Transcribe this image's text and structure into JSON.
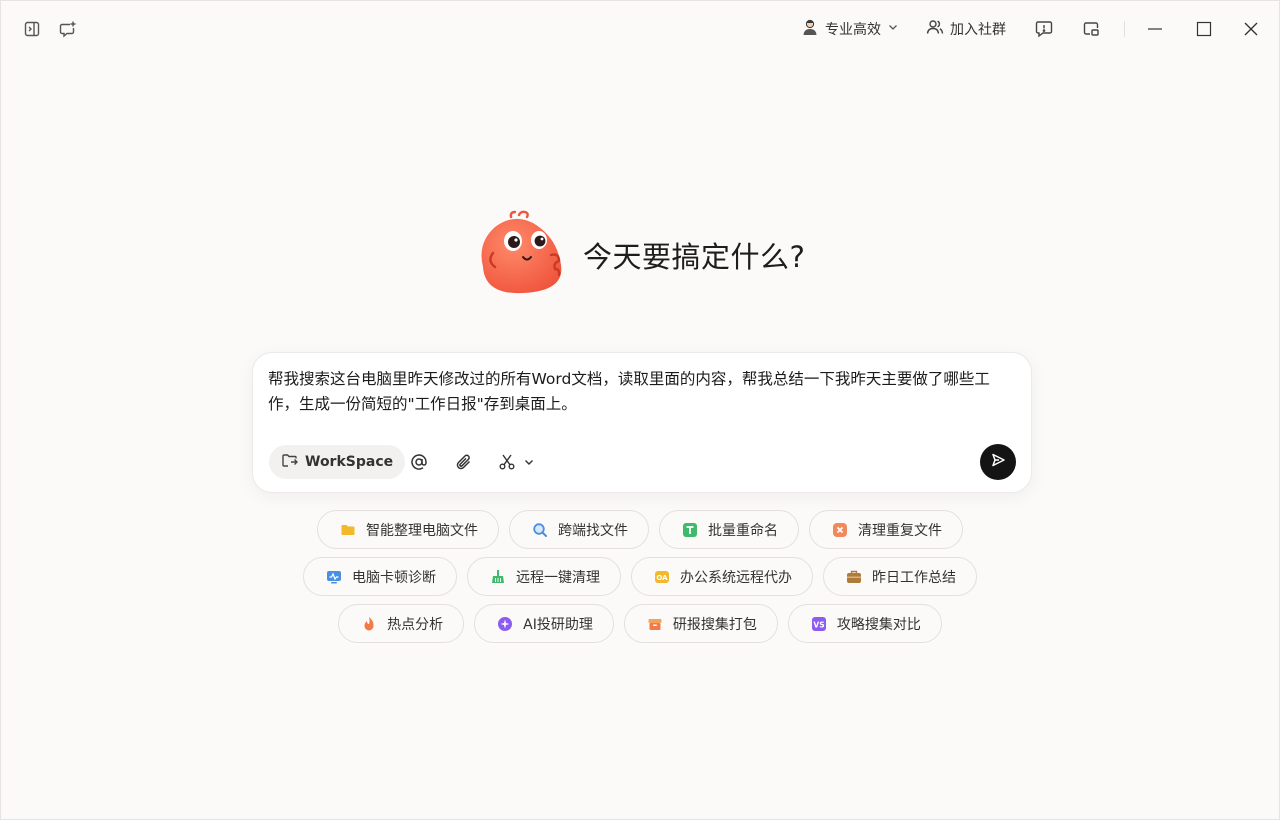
{
  "topbar": {
    "mode_label": "专业高效",
    "join_label": "加入社群"
  },
  "hero": {
    "title": "今天要搞定什么?"
  },
  "input": {
    "prompt": "帮我搜索这台电脑里昨天修改过的所有Word文档，读取里面的内容，帮我总结一下我昨天主要做了哪些工作，生成一份简短的\"工作日报\"存到桌面上。",
    "workspace_label": "WorkSpace"
  },
  "chips": {
    "row1": [
      {
        "label": "智能整理电脑文件",
        "icon": "folder-icon",
        "color": "#f2b92c"
      },
      {
        "label": "跨端找文件",
        "icon": "search-icon",
        "color": "#4a90e2"
      },
      {
        "label": "批量重命名",
        "icon": "t-icon",
        "color": "#3fb96b"
      },
      {
        "label": "清理重复文件",
        "icon": "x-icon",
        "color": "#f08a5d"
      }
    ],
    "row2": [
      {
        "label": "电脑卡顿诊断",
        "icon": "monitor-icon",
        "color": "#4a90e2"
      },
      {
        "label": "远程一键清理",
        "icon": "broom-icon",
        "color": "#3fb96b"
      },
      {
        "label": "办公系统远程代办",
        "icon": "oa-icon",
        "color": "#f2b92c"
      },
      {
        "label": "昨日工作总结",
        "icon": "briefcase-icon",
        "color": "#b07a3b"
      }
    ],
    "row3": [
      {
        "label": "热点分析",
        "icon": "fire-icon",
        "color": "#f07a4a"
      },
      {
        "label": "AI投研助理",
        "icon": "sparkle-icon",
        "color": "#8c5cf0"
      },
      {
        "label": "研报搜集打包",
        "icon": "package-icon",
        "color": "#f07a4a"
      },
      {
        "label": "攻略搜集对比",
        "icon": "vs-icon",
        "color": "#8c5cf0"
      }
    ]
  }
}
